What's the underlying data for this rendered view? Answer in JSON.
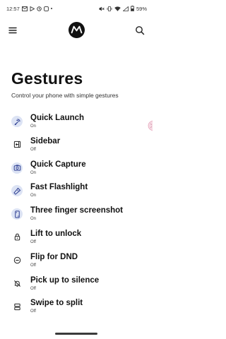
{
  "status_bar": {
    "time": "12:57",
    "battery": "59%"
  },
  "header": {
    "menu_icon": "hamburger-menu-icon",
    "logo_icon": "motorola-logo",
    "search_icon": "search-icon"
  },
  "page": {
    "title": "Gestures",
    "subtitle": "Control your phone with simple gestures"
  },
  "gestures": [
    {
      "label": "Quick Launch",
      "status": "On",
      "icon": "quick-launch-icon"
    },
    {
      "label": "Sidebar",
      "status": "Off",
      "icon": "sidebar-icon"
    },
    {
      "label": "Quick Capture",
      "status": "On",
      "icon": "camera-icon"
    },
    {
      "label": "Fast Flashlight",
      "status": "On",
      "icon": "flashlight-icon"
    },
    {
      "label": "Three finger screenshot",
      "status": "On",
      "icon": "screenshot-icon"
    },
    {
      "label": "Lift to unlock",
      "status": "Off",
      "icon": "lock-icon"
    },
    {
      "label": "Flip for DND",
      "status": "Off",
      "icon": "dnd-icon"
    },
    {
      "label": "Pick up to silence",
      "status": "Off",
      "icon": "bell-off-icon"
    },
    {
      "label": "Swipe to split",
      "status": "Off",
      "icon": "split-screen-icon"
    }
  ],
  "colors": {
    "accent": "#2e3f92",
    "icon_on_bg": "#dce3f4",
    "text": "#111111"
  }
}
